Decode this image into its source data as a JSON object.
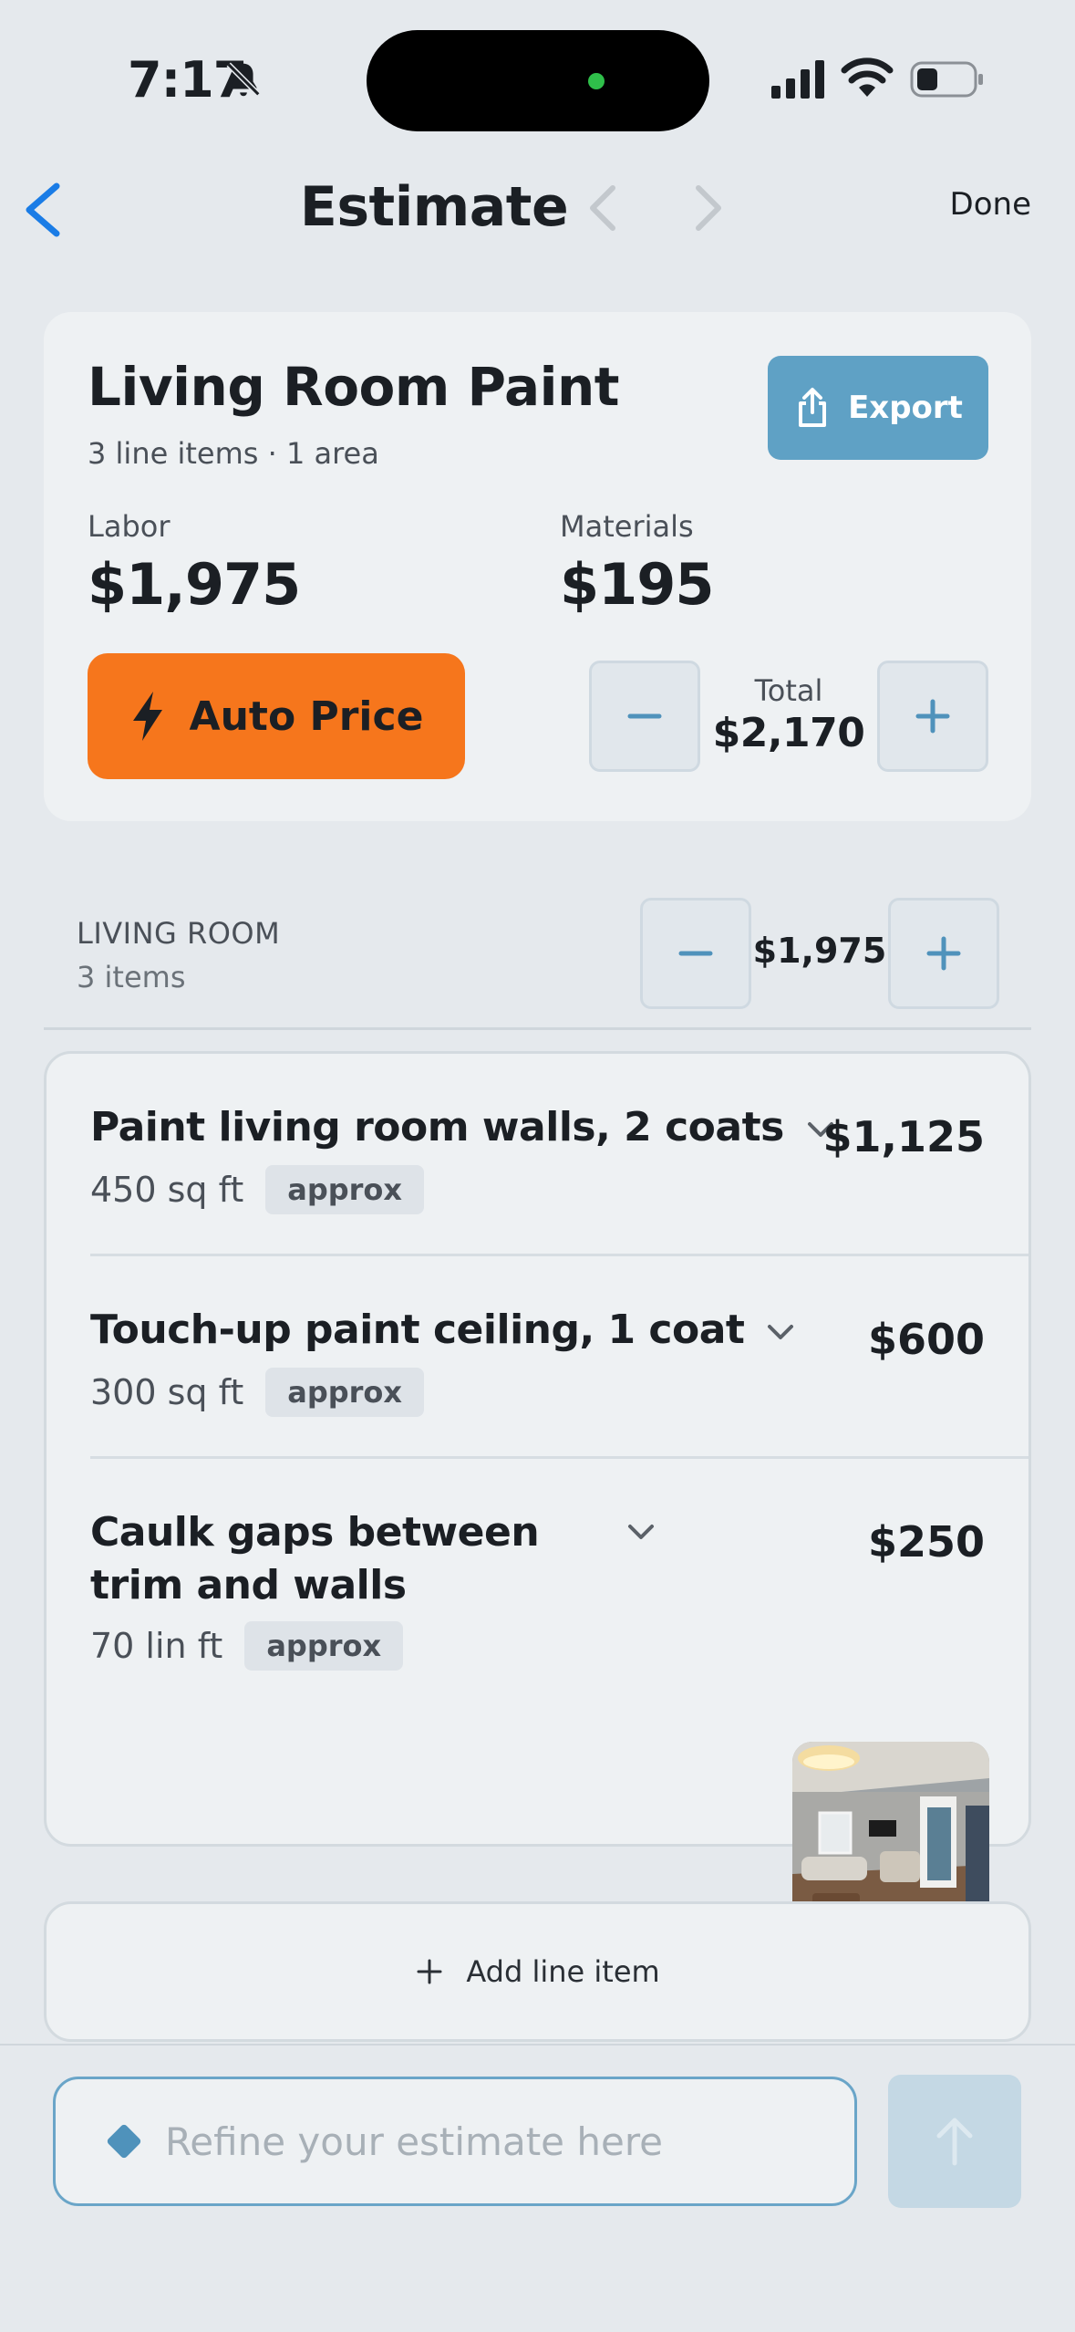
{
  "status_bar": {
    "time": "7:17"
  },
  "nav": {
    "title": "Estimate",
    "done_label": "Done"
  },
  "summary": {
    "project_name": "Living Room Paint",
    "subtitle": "3 line items · 1 area",
    "export_label": "Export",
    "labor_label": "Labor",
    "labor_value": "$1,975",
    "materials_label": "Materials",
    "materials_value": "$195",
    "auto_price_label": "Auto Price",
    "total_label": "Total",
    "total_value": "$2,170"
  },
  "section": {
    "name": "LIVING ROOM",
    "count": "3 items",
    "total": "$1,975"
  },
  "line_items": [
    {
      "title": "Paint living room walls, 2 coats",
      "quantity": "450 sq ft",
      "badge": "approx",
      "price": "$1,125"
    },
    {
      "title": "Touch-up paint ceiling, 1 coat",
      "quantity": "300 sq ft",
      "badge": "approx",
      "price": "$600"
    },
    {
      "title": "Caulk gaps between trim and walls",
      "quantity": "70 lin ft",
      "badge": "approx",
      "price": "$250"
    }
  ],
  "add_line_item_label": "Add line item",
  "refine": {
    "placeholder": "Refine your estimate here"
  },
  "colors": {
    "accent": "#1a7ce6",
    "export": "#5fa1c5",
    "auto_price": "#f6761c",
    "send_disabled": "#c4d8e4",
    "recording_dot": "#2fbf4a"
  },
  "icons": {
    "status": [
      "bell-slash-icon",
      "signal-icon",
      "wifi-icon",
      "battery-icon"
    ],
    "nav": [
      "chevron-left-icon",
      "chevron-right-icon"
    ],
    "actions": [
      "share-icon",
      "bolt-icon",
      "minus-icon",
      "plus-icon",
      "chevron-down-icon",
      "diamond-icon",
      "arrow-up-icon"
    ]
  }
}
